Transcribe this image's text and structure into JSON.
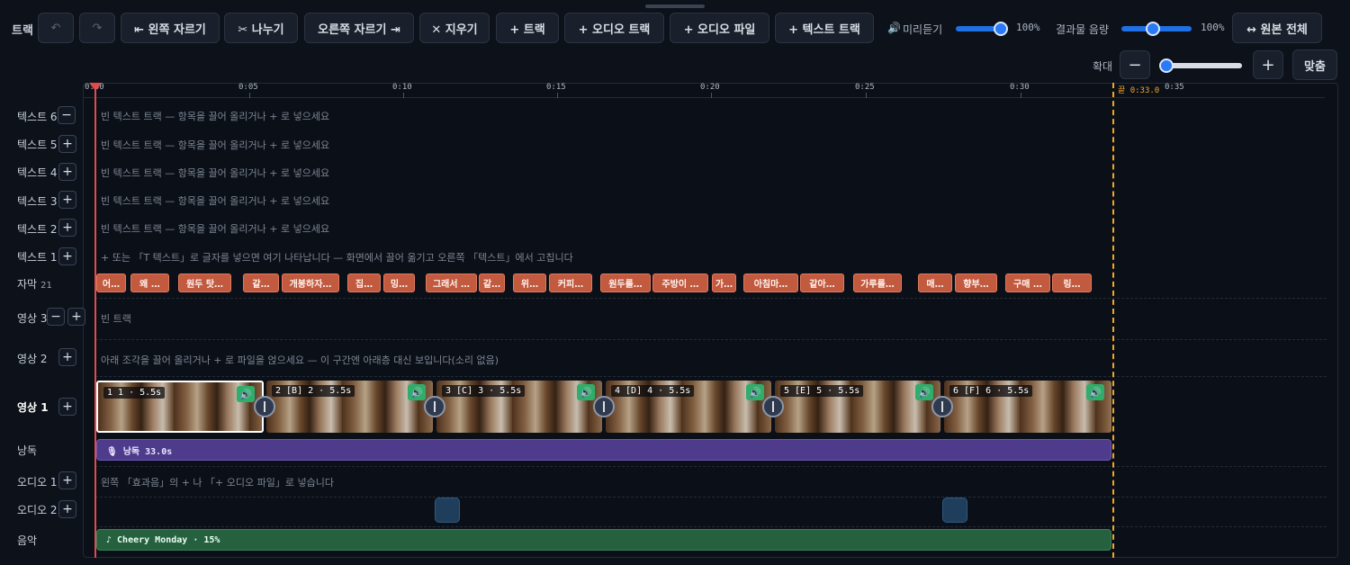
{
  "toolbar": {
    "title": "트랙",
    "undo_icon": "undo-icon",
    "redo_icon": "redo-icon",
    "trim_left": "⇤ 왼쪽 자르기",
    "split": "✂ 나누기",
    "trim_right": "오른쪽 자르기 ⇥",
    "delete": "✕ 지우기",
    "add_track": "+ 트랙",
    "add_audio_track": "+ 오디오 트랙",
    "add_audio_file": "+ 오디오 파일",
    "add_text_track": "+ 텍스트 트랙",
    "preview_label": "미리듣기",
    "preview_volume": "100%",
    "output_label": "결과물 음량",
    "output_volume": "100%",
    "full_original": "↔ 원본 전체"
  },
  "zoom": {
    "label": "확대",
    "minus": "−",
    "plus": "+",
    "fit": "맞춤"
  },
  "ruler": {
    "ticks": [
      "0:00",
      "0:05",
      "0:10",
      "0:15",
      "0:20",
      "0:25",
      "0:30",
      "0:35"
    ],
    "end_label": "끝 0:33.0"
  },
  "tracks": {
    "text6": "텍스트 6",
    "text5": "텍스트 5",
    "text4": "텍스트 4",
    "text3": "텍스트 3",
    "text2": "텍스트 2",
    "text1": "텍스트 1",
    "subtitles": "자막",
    "subtitles_count": "21",
    "video3": "영상 3",
    "video2": "영상 2",
    "video1": "영상 1",
    "narration": "낭독",
    "audio1": "오디오 1",
    "audio2": "오디오 2",
    "music": "음악"
  },
  "hints": {
    "empty_text_track": "빈 텍스트 트랙 — 항목을 끌어 올리거나 + 로 넣으세요",
    "text1": "+ 또는 「T 텍스트」로 글자를 넣으면 여기 나타납니다 — 화면에서 끌어 옮기고 오른쪽 「텍스트」에서 고칩니다",
    "video3": "빈 트랙",
    "video2": "아래 조각을 끌어 올리거나 + 로 파일을 얹으세요 — 이 구간엔 아래층 대신 보입니다(소리 없음)",
    "audio1": "왼쪽 「효과음」의 + 나 「+ 오디오 파일」로 넣습니다"
  },
  "subtitles": [
    "어…",
    "왜 …",
    "원두 탓…",
    "같…",
    "개봉하자…",
    "집…",
    "밍…",
    "그래서 …",
    "같…",
    "위…",
    "커피…",
    "원두를…",
    "주방이 …",
    "가…",
    "아침마…",
    "같아…",
    "가루를…",
    "매…",
    "향부…",
    "구매 …",
    "링…"
  ],
  "clips": [
    "1 1 · 5.5s",
    "2 [B] 2 · 5.5s",
    "3 [C] 3 · 5.5s",
    "4 [D] 4 · 5.5s",
    "5 [E] 5 · 5.5s",
    "6 [F] 6 · 5.5s"
  ],
  "narration_clip": "🎙 낭독 33.0s",
  "music_clip": "♪ Cheery Monday · 15%"
}
